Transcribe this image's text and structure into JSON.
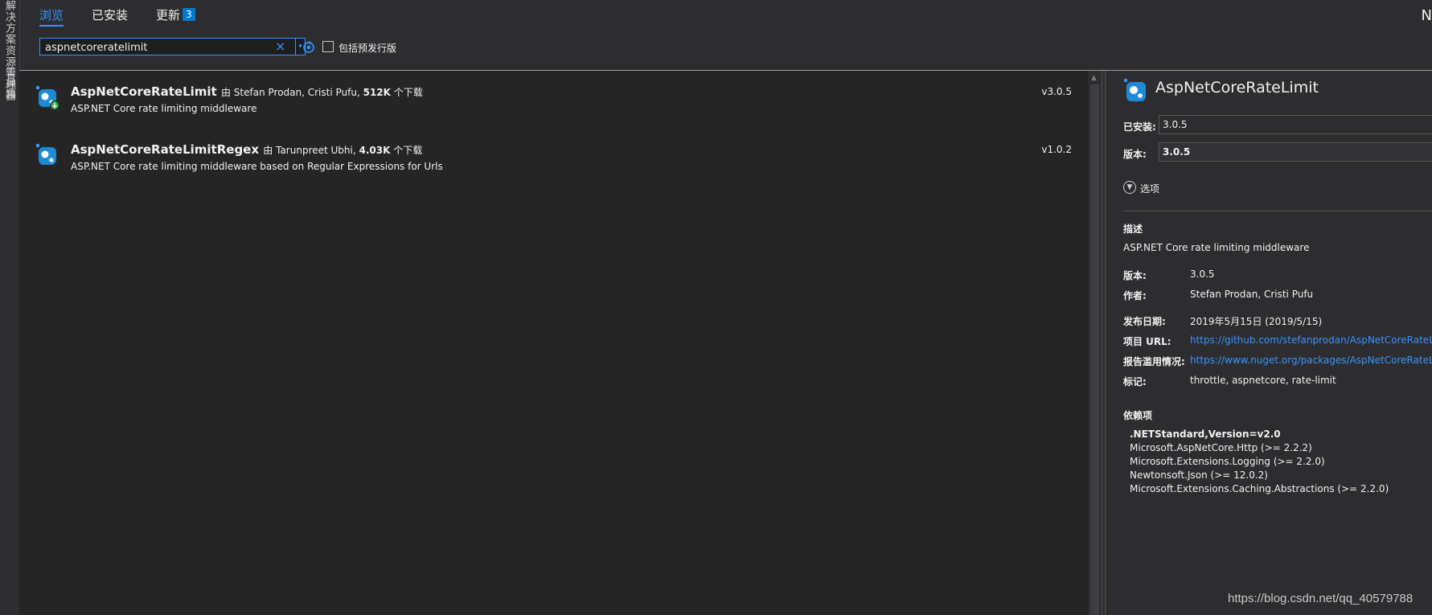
{
  "left_dock": {
    "items": [
      "解决方案资源管理器",
      "工具箱"
    ]
  },
  "tabs": [
    {
      "label": "浏览",
      "active": true
    },
    {
      "label": "已安装",
      "active": false
    },
    {
      "label": "更新",
      "active": false,
      "badge": "3"
    }
  ],
  "top_right_char": "N",
  "search": {
    "value": "aspnetcoreratelimit",
    "clear_glyph": "×",
    "dropdown_glyph": "▾",
    "refresh_icon": "refresh-icon",
    "prerelease_label": "包括预发行版",
    "prerelease_checked": false
  },
  "packages": [
    {
      "name": "AspNetCoreRateLimit",
      "by": "由",
      "authors": "Stefan Prodan, Cristi Pufu,",
      "downloads": "512K",
      "downloads_suffix": "个下载",
      "description": "ASP.NET Core rate limiting middleware",
      "version": "v3.0.5",
      "installed": true
    },
    {
      "name": "AspNetCoreRateLimitRegex",
      "by": "由",
      "authors": "Tarunpreet Ubhi,",
      "downloads": "4.03K",
      "downloads_suffix": "个下载",
      "description": "ASP.NET Core rate limiting middleware based on Regular Expressions for Urls",
      "version": "v1.0.2",
      "installed": false
    }
  ],
  "details": {
    "title": "AspNetCoreRateLimit",
    "installed_label": "已安装:",
    "installed_value": "3.0.5",
    "version_label": "版本:",
    "version_value": "3.0.5",
    "options_label": "选项",
    "description_heading": "描述",
    "description": "ASP.NET Core rate limiting middleware",
    "meta": {
      "version_label": "版本:",
      "version": "3.0.5",
      "author_label": "作者:",
      "author": "Stefan Prodan, Cristi Pufu",
      "date_label": "发布日期:",
      "date": "2019年5月15日 (2019/5/15)",
      "project_url_label": "项目 URL:",
      "project_url": "https://github.com/stefanprodan/AspNetCoreRateLi",
      "report_label": "报告滥用情况:",
      "report_url": "https://www.nuget.org/packages/AspNetCoreRateLi",
      "tags_label": "标记:",
      "tags": "throttle, aspnetcore, rate-limit"
    },
    "dependencies_heading": "依赖项",
    "dependency_group": ".NETStandard,Version=v2.0",
    "dependencies": [
      "Microsoft.AspNetCore.Http (>= 2.2.2)",
      "Microsoft.Extensions.Logging (>= 2.2.0)",
      "Newtonsoft.Json (>= 12.0.2)",
      "Microsoft.Extensions.Caching.Abstractions (>= 2.2.0)"
    ]
  },
  "watermark": "https://blog.csdn.net/qq_40579788",
  "colors": {
    "accent": "#3794ff",
    "badge": "#007acc",
    "background": "#2d2d30",
    "list_background": "#252526"
  }
}
